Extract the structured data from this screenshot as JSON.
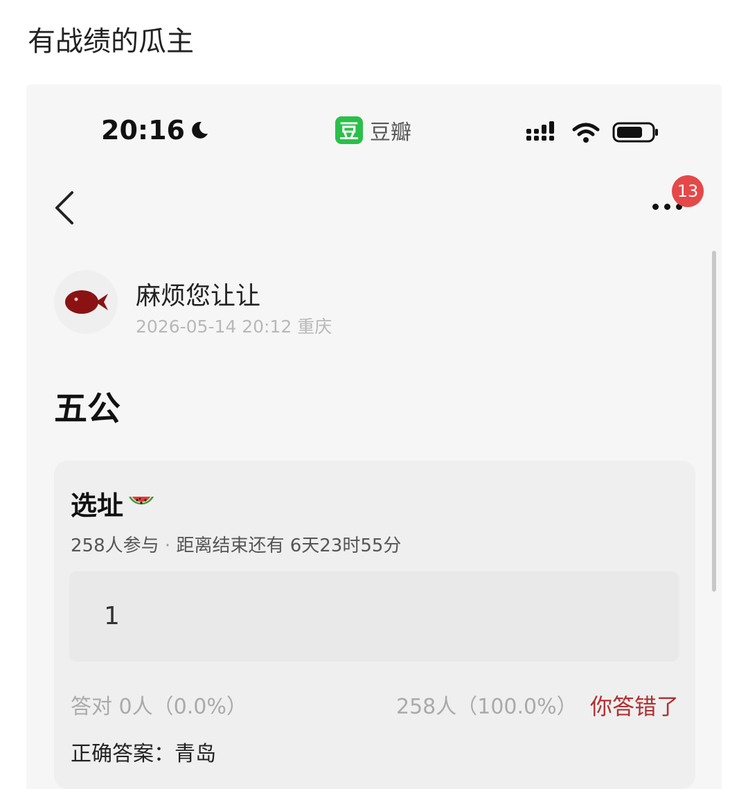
{
  "caption": "有战绩的瓜主",
  "status_bar": {
    "time": "20:16",
    "app_logo_char": "豆",
    "app_name": "豆瓣",
    "icons": [
      "moon-icon",
      "signal-icon",
      "wifi-icon",
      "battery-icon"
    ]
  },
  "nav": {
    "notification_count": "13",
    "icons": [
      "back-icon",
      "more-icon"
    ]
  },
  "post": {
    "author": "麻烦您让让",
    "meta": "2026-05-14 20:12  重庆",
    "title": "五公"
  },
  "quiz": {
    "title": "选址",
    "title_icon": "watermelon-icon",
    "participants": "258人参与",
    "separator": "·",
    "remaining": "距离结束还有 6天23时55分",
    "option": "1",
    "correct_stat": "答对  0人（0.0%）",
    "wrong_stat": "258人（100.0%）",
    "result": "你答错了",
    "answer": "正确答案：青岛"
  },
  "colors": {
    "douban_green": "#2bbf4a",
    "badge_red": "#e54848",
    "wrong_red": "#b03030"
  }
}
